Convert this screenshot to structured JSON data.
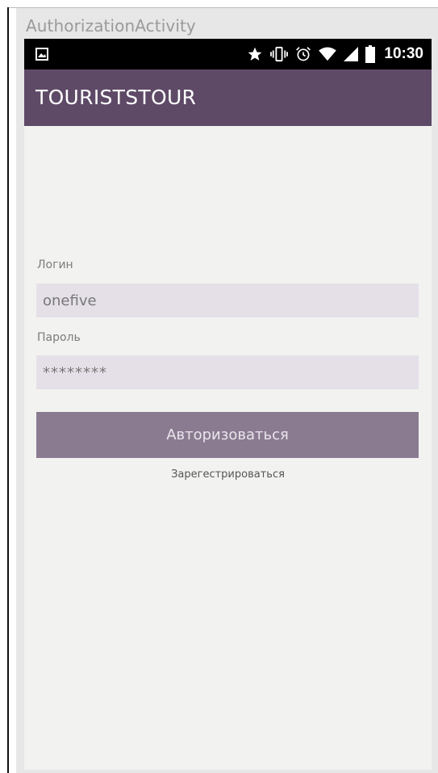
{
  "window": {
    "title": "AuthorizationActivity"
  },
  "status_bar": {
    "time": "10:30",
    "icons": [
      "image-icon",
      "star-icon",
      "vibrate-icon",
      "alarm-icon",
      "wifi-icon",
      "signal-icon",
      "battery-icon"
    ]
  },
  "app_bar": {
    "title": "TOURISTSTOUR",
    "color": "#5e4a67"
  },
  "form": {
    "login_label": "Логин",
    "login_value": "onefive",
    "password_label": "Пароль",
    "password_value": "********",
    "submit_label": "Авторизоваться",
    "register_label": "Зарегестрироваться"
  },
  "colors": {
    "accent": "#8b7b91",
    "input_bg": "#e5e0e8",
    "screen_bg": "#f2f3f1"
  }
}
